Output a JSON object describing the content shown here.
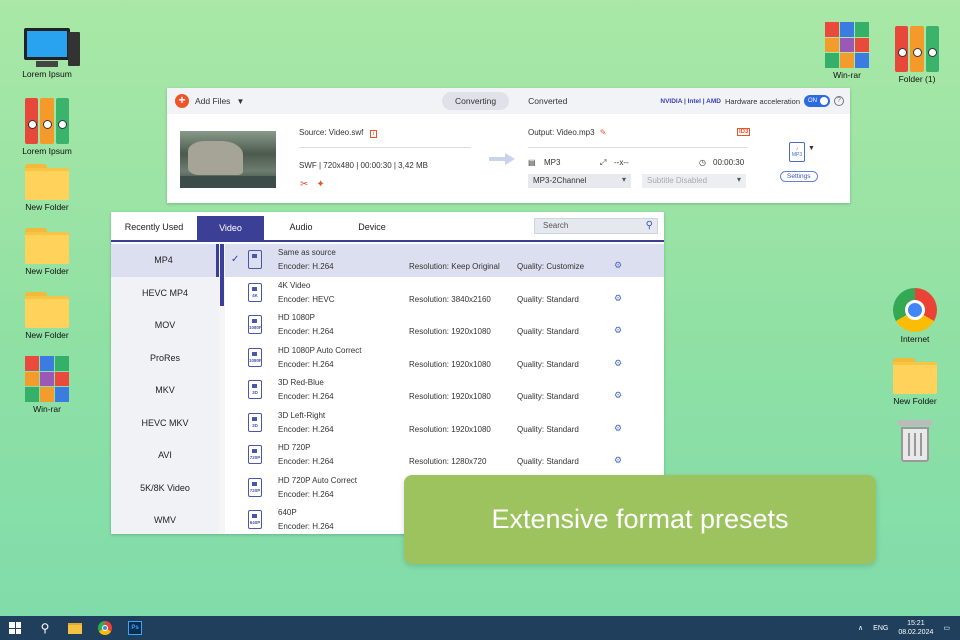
{
  "desktop": {
    "left_icons": [
      "Lorem Ipsum",
      "Lorem Ipsum",
      "New Folder",
      "New Folder",
      "New Folder",
      "Win-rar"
    ],
    "right_icons": [
      "Win-rar",
      "Folder (1)",
      "Internet",
      "New Folder"
    ]
  },
  "converter": {
    "add_files": "Add Files",
    "tabs": [
      "Converting",
      "Converted"
    ],
    "hw_brands": "NVIDIA | Intel | AMD",
    "hw_label": "Hardware acceleration",
    "hw_toggle": "ON",
    "source_label": "Source: Video.swf",
    "source_meta": "SWF | 720x480 | 00:00:30 | 3,42 MB",
    "output_label": "Output: Video.mp3",
    "out_format": "MP3",
    "out_size": "--x--",
    "out_duration": "00:00:30",
    "audio_select": "MP3-2Channel",
    "subtitle_select": "Subtitle Disabled",
    "settings": "Settings",
    "format_icon": "MP3"
  },
  "formats": {
    "tabs": [
      "Recently Used",
      "Video",
      "Audio",
      "Device"
    ],
    "active_tab": "Video",
    "search_placeholder": "Search",
    "categories": [
      "MP4",
      "HEVC MP4",
      "MOV",
      "ProRes",
      "MKV",
      "HEVC MKV",
      "AVI",
      "5K/8K Video",
      "WMV"
    ],
    "active_category": "MP4",
    "presets": [
      {
        "name": "Same as source",
        "encoder": "Encoder: H.264",
        "resolution": "Resolution: Keep Original",
        "quality": "Quality: Customize",
        "badge": "",
        "selected": true
      },
      {
        "name": "4K Video",
        "encoder": "Encoder: HEVC",
        "resolution": "Resolution: 3840x2160",
        "quality": "Quality: Standard",
        "badge": "4K"
      },
      {
        "name": "HD 1080P",
        "encoder": "Encoder: H.264",
        "resolution": "Resolution: 1920x1080",
        "quality": "Quality: Standard",
        "badge": "1080P"
      },
      {
        "name": "HD 1080P Auto Correct",
        "encoder": "Encoder: H.264",
        "resolution": "Resolution: 1920x1080",
        "quality": "Quality: Standard",
        "badge": "1080P"
      },
      {
        "name": "3D Red-Blue",
        "encoder": "Encoder: H.264",
        "resolution": "Resolution: 1920x1080",
        "quality": "Quality: Standard",
        "badge": "3D"
      },
      {
        "name": "3D Left-Right",
        "encoder": "Encoder: H.264",
        "resolution": "Resolution: 1920x1080",
        "quality": "Quality: Standard",
        "badge": "3D"
      },
      {
        "name": "HD 720P",
        "encoder": "Encoder: H.264",
        "resolution": "Resolution: 1280x720",
        "quality": "Quality: Standard",
        "badge": "720P"
      },
      {
        "name": "HD 720P Auto Correct",
        "encoder": "Encoder: H.264",
        "resolution": "",
        "quality": "",
        "badge": "720P"
      },
      {
        "name": "640P",
        "encoder": "Encoder: H.264",
        "resolution": "",
        "quality": "",
        "badge": "640P"
      }
    ]
  },
  "banner": "Extensive format presets",
  "taskbar": {
    "lang": "ENG",
    "time": "15:21",
    "date": "08.02.2024",
    "ps": "Ps"
  }
}
